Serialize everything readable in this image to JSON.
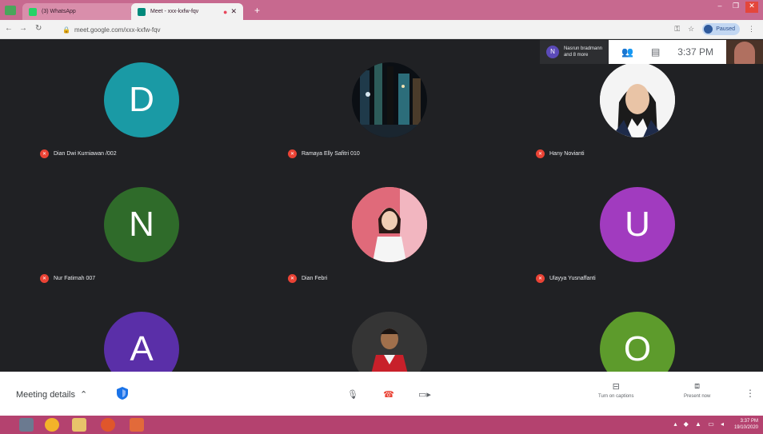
{
  "browser": {
    "tabs": [
      {
        "title": "(3) WhatsApp",
        "active": false
      },
      {
        "title": "Meet - xxx-kxfw-fqv",
        "active": true
      }
    ],
    "url": "meet.google.com/xxx-kxfw-fqv",
    "profile_label": "Paused"
  },
  "meet": {
    "participants_note": {
      "badge": "N",
      "line1": "Nasrun bradmann",
      "line2": "and 8 more"
    },
    "clock": "3:37 PM",
    "tiles": [
      {
        "name": "Dian Dwi Kurniawan /002",
        "initial": "D",
        "color": "#1a9aa5",
        "type": "letter"
      },
      {
        "name": "Ramaya Elly Safitri 010",
        "initial": "",
        "color": "#111111",
        "type": "photo-city"
      },
      {
        "name": "Hany Novianti",
        "initial": "",
        "color": "#f2f2f2",
        "type": "photo-hijab"
      },
      {
        "name": "Nur Fatimah 007",
        "initial": "N",
        "color": "#2f6b2a",
        "type": "letter"
      },
      {
        "name": "Dian Febri",
        "initial": "",
        "color": "#e88a94",
        "type": "photo-girl"
      },
      {
        "name": "Ulayya Yusnaffanti",
        "initial": "U",
        "color": "#a13bbf",
        "type": "letter"
      },
      {
        "name": "",
        "initial": "A",
        "color": "#5a2fa8",
        "type": "letter"
      },
      {
        "name": "",
        "initial": "",
        "color": "#3a3a3a",
        "type": "photo-boy"
      },
      {
        "name": "",
        "initial": "O",
        "color": "#5d9b2c",
        "type": "letter"
      }
    ]
  },
  "bottom": {
    "meeting_details": "Meeting details",
    "captions_label": "Turn on captions",
    "present_label": "Present now"
  },
  "taskbar": {
    "time": "3:37 PM",
    "date": "19/10/2020"
  }
}
